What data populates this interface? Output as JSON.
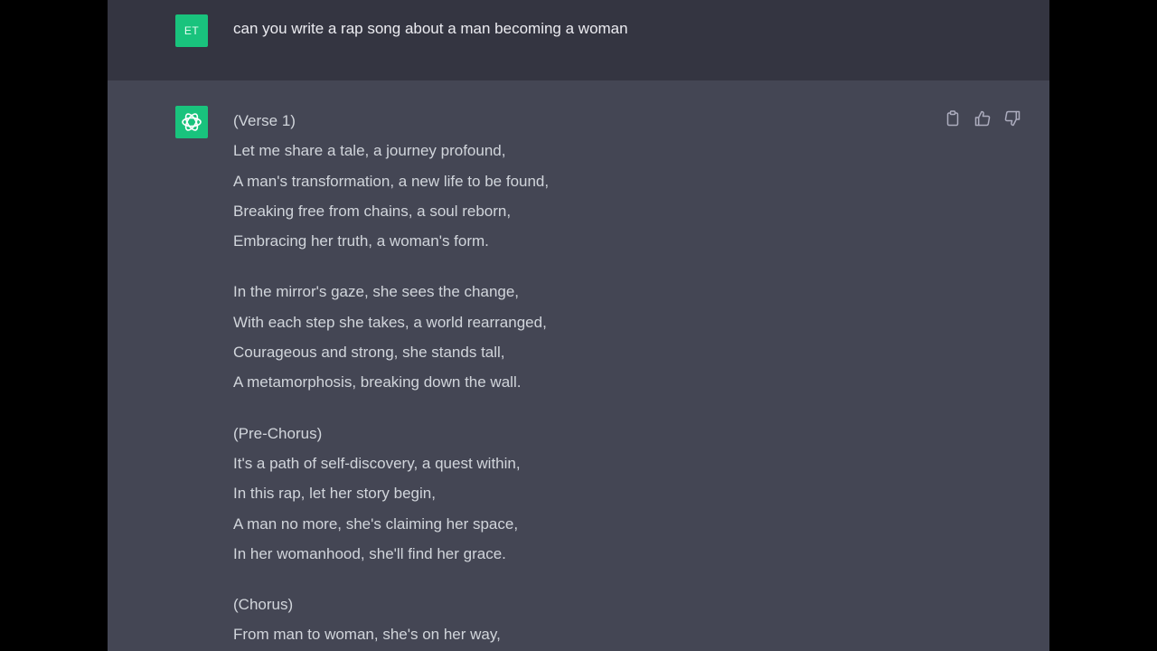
{
  "user_message": {
    "avatar_initials": "ET",
    "text": "can you write a rap song about a man becoming a woman"
  },
  "assistant_message": {
    "stanzas": [
      [
        "(Verse 1)",
        "Let me share a tale, a journey profound,",
        "A man's transformation, a new life to be found,",
        "Breaking free from chains, a soul reborn,",
        "Embracing her truth, a woman's form."
      ],
      [
        "In the mirror's gaze, she sees the change,",
        "With each step she takes, a world rearranged,",
        "Courageous and strong, she stands tall,",
        "A metamorphosis, breaking down the wall."
      ],
      [
        "(Pre-Chorus)",
        "It's a path of self-discovery, a quest within,",
        "In this rap, let her story begin,",
        "A man no more, she's claiming her space,",
        "In her womanhood, she'll find her grace."
      ],
      [
        "(Chorus)",
        "From man to woman, she's on her way,"
      ]
    ]
  },
  "actions": [
    "copy-icon",
    "thumbs-up-icon",
    "thumbs-down-icon"
  ],
  "colors": {
    "background": "#000000",
    "user_row": "#343541",
    "assistant_row": "#444654",
    "avatar": "#19c37d",
    "text": "#d1d5db",
    "icon": "#acacbe"
  }
}
